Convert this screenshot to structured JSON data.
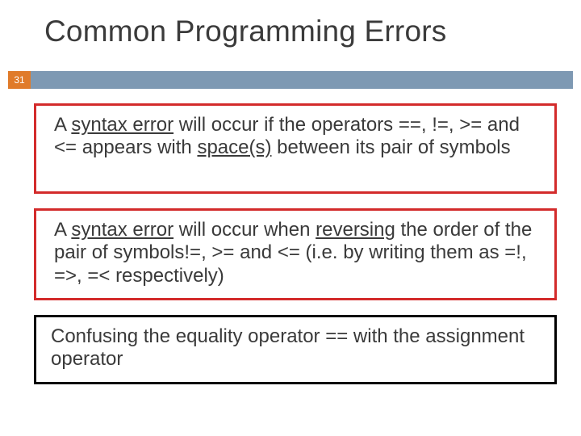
{
  "title": "Common Programming Errors",
  "slide_number": "31",
  "boxes": [
    {
      "p1a": "A ",
      "p1b": "syntax error",
      "p1c": " will occur if the operators ==, !=, >= and <= appears with ",
      "p1d": "space(s)",
      "p1e": " between its pair of symbols"
    },
    {
      "p2a": "A ",
      "p2b": "syntax error",
      "p2c": " will occur when ",
      "p2d": "reversing",
      "p2e": " the order of the pair of symbols!=, >= and <= (i.e. by writing them as =!, =>, =< respectively)"
    },
    {
      "p3": "Confusing the equality operator == with the assignment operator"
    }
  ]
}
